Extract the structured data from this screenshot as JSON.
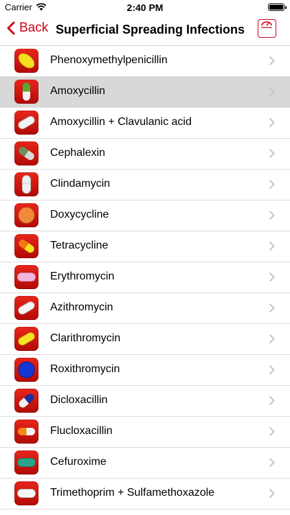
{
  "status_bar": {
    "carrier": "Carrier",
    "time": "2:40 PM"
  },
  "nav": {
    "back_label": "Back",
    "title": "Superficial Spreading Infections",
    "accent_color": "#d0021b"
  },
  "rows": [
    {
      "label": "Phenoxymethylpenicillin",
      "pill": "yellow-oval-tablet-icon",
      "selected": false
    },
    {
      "label": "Amoxycillin",
      "pill": "green-white-capsule-icon",
      "selected": true
    },
    {
      "label": "Amoxycillin + Clavulanic acid",
      "pill": "white-oblong-tablet-icon",
      "selected": false
    },
    {
      "label": "Cephalexin",
      "pill": "green-grey-capsule-icon",
      "selected": false
    },
    {
      "label": "Clindamycin",
      "pill": "white-capsule-icon",
      "selected": false
    },
    {
      "label": "Doxycycline",
      "pill": "orange-round-tablet-icon",
      "selected": false
    },
    {
      "label": "Tetracycline",
      "pill": "orange-yellow-capsule-icon",
      "selected": false
    },
    {
      "label": "Erythromycin",
      "pill": "pink-oval-tablet-icon",
      "selected": false
    },
    {
      "label": "Azithromycin",
      "pill": "white-oblong-tablet-icon",
      "selected": false
    },
    {
      "label": "Clarithromycin",
      "pill": "yellow-oblong-tablet-icon",
      "selected": false
    },
    {
      "label": "Roxithromycin",
      "pill": "blue-round-tablet-icon",
      "selected": false
    },
    {
      "label": "Dicloxacillin",
      "pill": "blue-white-capsule-icon",
      "selected": false
    },
    {
      "label": "Flucloxacillin",
      "pill": "orange-white-capsule-icon",
      "selected": false
    },
    {
      "label": "Cefuroxime",
      "pill": "teal-oval-tablet-icon",
      "selected": false
    },
    {
      "label": "Trimethoprim + Sulfamethoxazole",
      "pill": "white-oval-tablet-icon",
      "selected": false
    }
  ]
}
